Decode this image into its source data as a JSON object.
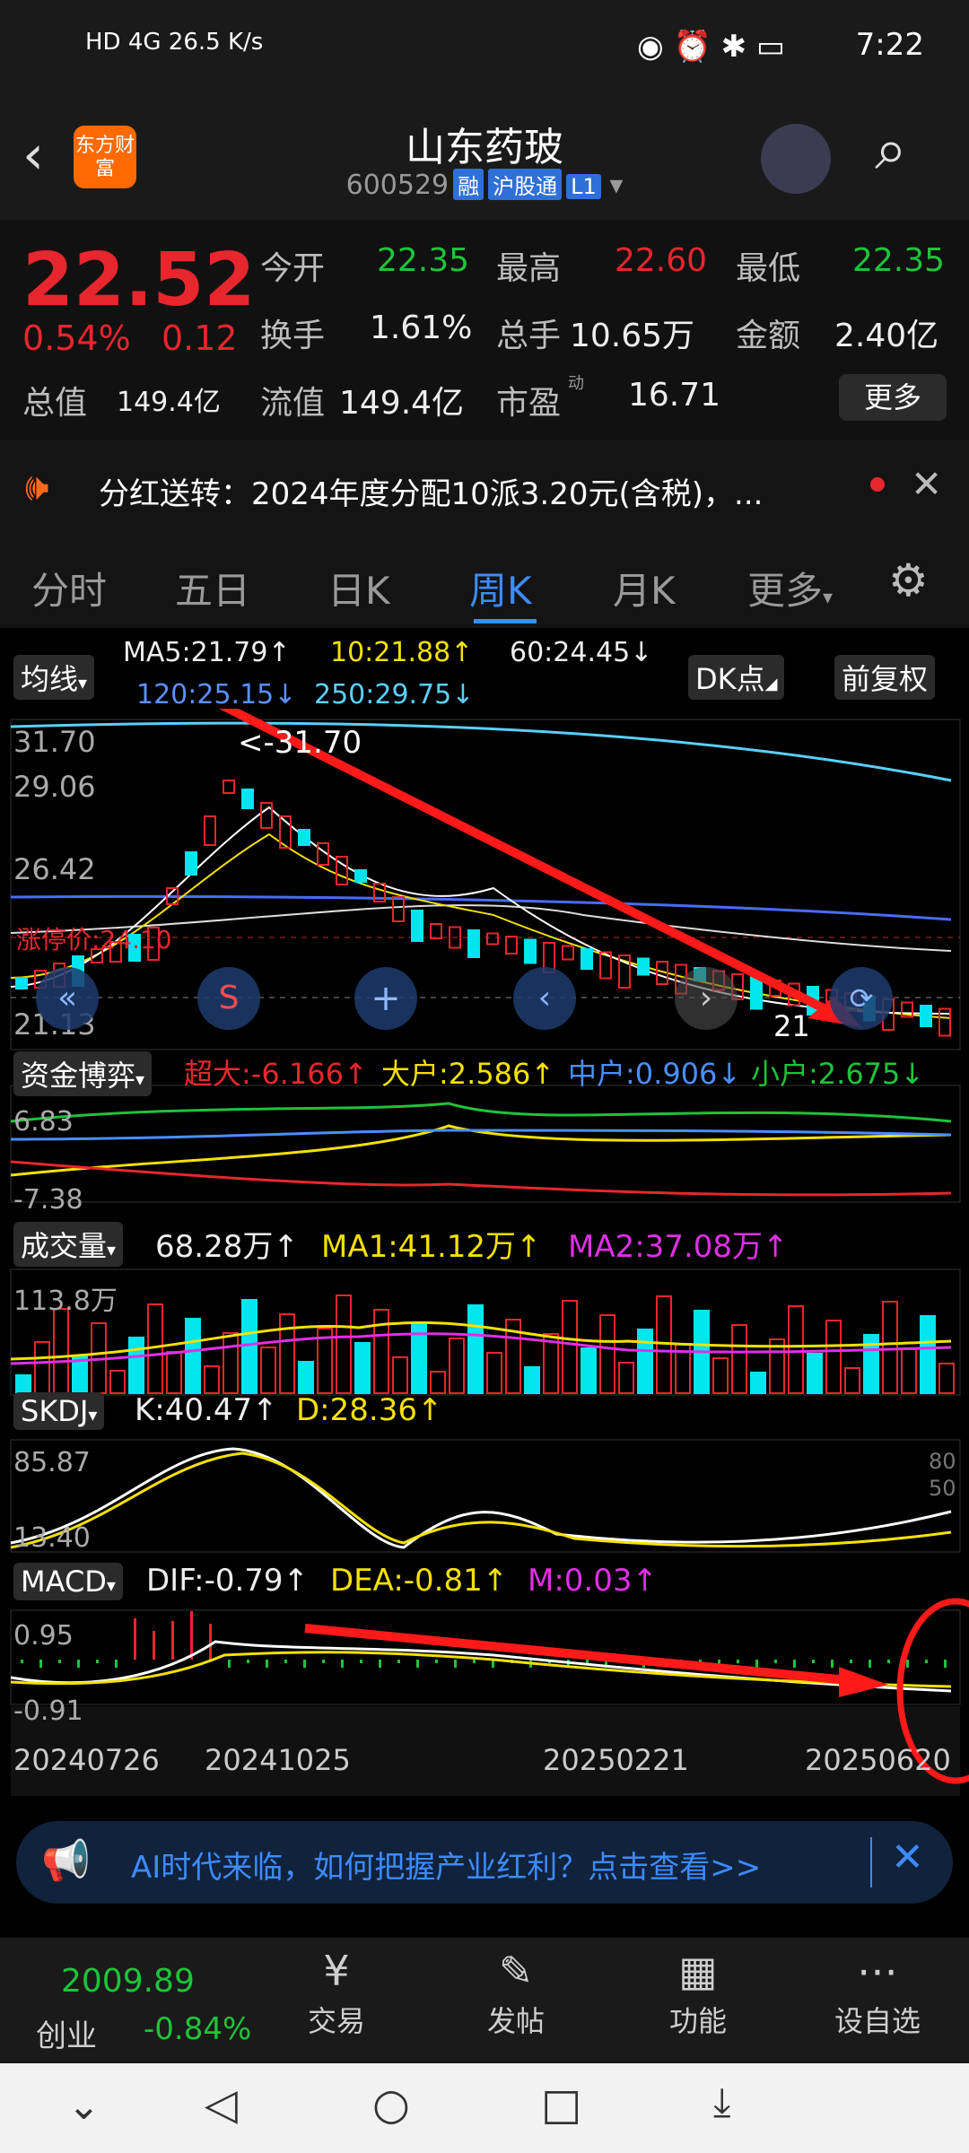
{
  "status": {
    "left": "HD 4G 26.5 K/s",
    "time": "7:22"
  },
  "header": {
    "title": "山东药玻",
    "code": "600529",
    "tags": [
      "融",
      "沪股通",
      "L1"
    ],
    "logo": "东方财富"
  },
  "quote": {
    "price": "22.52",
    "pct": "0.54%",
    "chg": "0.12",
    "open_l": "今开",
    "open": "22.35",
    "high_l": "最高",
    "high": "22.60",
    "low_l": "最低",
    "low": "22.35",
    "turn_l": "换手",
    "turn": "1.61%",
    "vol_l": "总手",
    "vol": "10.65万",
    "amt_l": "金额",
    "amt": "2.40亿",
    "mcap_l": "总值",
    "mcap": "149.4亿",
    "fcap_l": "流值",
    "fcap": "149.4亿",
    "pe_l": "市盈",
    "pe_sup": "动",
    "pe": "16.71",
    "more": "更多"
  },
  "notice": {
    "text": "分红送转：2024年度分配10派3.20元(含税)，..."
  },
  "tabs": [
    "分时",
    "五日",
    "日K",
    "周K",
    "月K",
    "更多"
  ],
  "chart": {
    "ma_btn": "均线",
    "ma5": "MA5:21.79↑",
    "ma10": "10:21.88↑",
    "ma60": "60:24.45↓",
    "ma120": "120:25.15↓",
    "ma250": "250:29.75↓",
    "dk_btn": "DK点",
    "fq_btn": "前复权",
    "y_top": "31.70",
    "y_2": "29.06",
    "y_3": "26.42",
    "y_low": "21.13",
    "peak_label": "<-31.70",
    "limit_label": "涨停价:24.10",
    "low_mark": "21"
  },
  "capital": {
    "btn": "资金博弈",
    "big": "超大:-6.166↑",
    "large": "大户:2.586↑",
    "mid": "中户:0.906↓",
    "small": "小户:2.675↓",
    "y_top": "6.83",
    "y_bot": "-7.38"
  },
  "volume": {
    "btn": "成交量",
    "val": "68.28万↑",
    "ma1": "MA1:41.12万↑",
    "ma2": "MA2:37.08万↑",
    "y_top": "113.8万"
  },
  "skdj": {
    "btn": "SKDJ",
    "k": "K:40.47↑",
    "d": "D:28.36↑",
    "y_top": "85.87",
    "y_bot": "13.40",
    "r80": "80",
    "r50": "50"
  },
  "macd": {
    "btn": "MACD",
    "dif": "DIF:-0.79↑",
    "dea": "DEA:-0.81↑",
    "m": "M:0.03↑",
    "y_top": "0.95",
    "y_bot": "-0.91"
  },
  "dates": [
    "20240726",
    "20241025",
    "20250221",
    "20250620"
  ],
  "ad": {
    "text": "AI时代来临，如何把握产业红利？点击查看>>"
  },
  "bottom": {
    "index": "2009.89",
    "index_name": "创业",
    "index_chg": "-0.84%",
    "items": [
      "交易",
      "发帖",
      "功能",
      "设自选"
    ]
  }
}
